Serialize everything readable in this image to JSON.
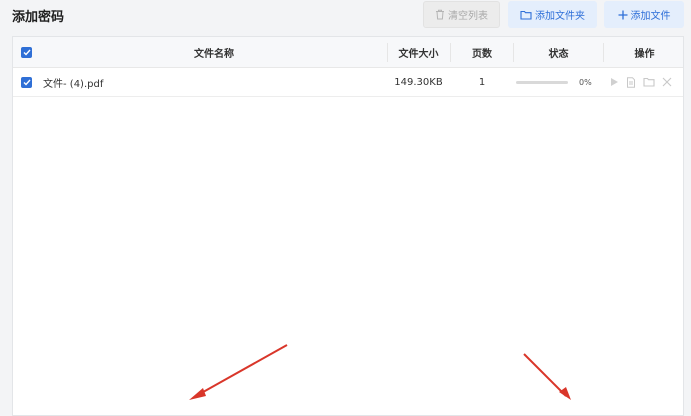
{
  "title": "添加密码",
  "toolbar": {
    "clear_label": "清空列表",
    "add_folder_label": "添加文件夹",
    "add_file_label": "添加文件"
  },
  "table": {
    "columns": [
      "文件名称",
      "文件大小",
      "页数",
      "状态",
      "操作"
    ],
    "rows": [
      {
        "name": "文件- (4).pdf",
        "size": "149.30KB",
        "pages": "1",
        "progress": 0,
        "status": "0%"
      }
    ]
  },
  "icons": {
    "clear": "trash-icon",
    "add_folder": "folder-icon",
    "add_file": "plus-icon",
    "actions": [
      "play-icon",
      "document-icon",
      "folder-icon",
      "close-icon"
    ]
  },
  "colors": {
    "accent": "#2f6fd6",
    "arrow": "#d9362a",
    "disabled": "#a9a9a9"
  }
}
